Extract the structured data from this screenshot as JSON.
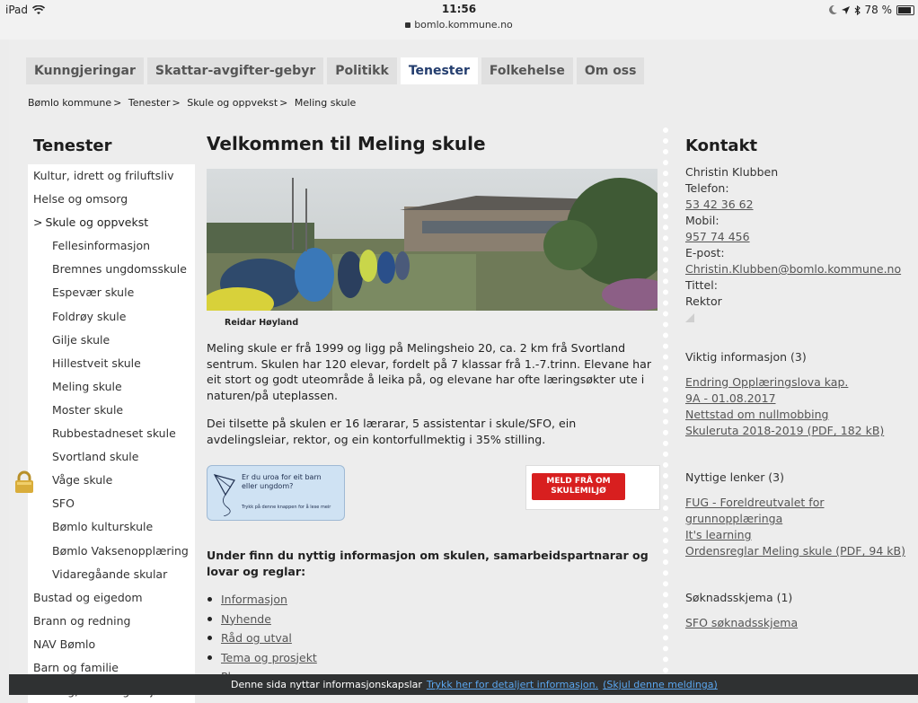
{
  "status_bar": {
    "device": "iPad",
    "time": "11:56",
    "url": "bomlo.kommune.no",
    "battery": "78 %",
    "battery_level": 0.78,
    "icons": [
      "wifi-icon",
      "moon-icon",
      "location-icon",
      "bluetooth-icon",
      "battery-icon"
    ]
  },
  "topnav": [
    {
      "label": "Kunngjeringar"
    },
    {
      "label": "Skattar-avgifter-gebyr"
    },
    {
      "label": "Politikk"
    },
    {
      "label": "Tenester",
      "active": true
    },
    {
      "label": "Folkehelse"
    },
    {
      "label": "Om oss"
    }
  ],
  "breadcrumb": [
    "Bømlo kommune",
    "Tenester",
    "Skule og oppvekst",
    "Meling skule"
  ],
  "breadcrumb_sep": ">",
  "sidebar": {
    "title": "Tenester",
    "items": [
      {
        "label": "Kultur, idrett og friluftsliv",
        "level": 0
      },
      {
        "label": "Helse og omsorg",
        "level": 0
      },
      {
        "label": "Skule og oppvekst",
        "level": 0,
        "selected": true,
        "prefix": ">"
      },
      {
        "label": "Fellesinformasjon",
        "level": 1
      },
      {
        "label": "Bremnes ungdomsskule",
        "level": 1
      },
      {
        "label": "Espevær skule",
        "level": 1
      },
      {
        "label": "Foldrøy skule",
        "level": 1
      },
      {
        "label": "Gilje skule",
        "level": 1
      },
      {
        "label": "Hillestveit skule",
        "level": 1
      },
      {
        "label": "Meling skule",
        "level": 1
      },
      {
        "label": "Moster skule",
        "level": 1
      },
      {
        "label": "Rubbestadneset skule",
        "level": 1
      },
      {
        "label": "Svortland skule",
        "level": 1
      },
      {
        "label": "Våge skule",
        "level": 1
      },
      {
        "label": "SFO",
        "level": 1
      },
      {
        "label": "Bømlo kulturskule",
        "level": 1
      },
      {
        "label": "Bømlo Vaksenopplæring",
        "level": 1
      },
      {
        "label": "Vidaregåande skular",
        "level": 1
      },
      {
        "label": "Bustad og eigedom",
        "level": 0
      },
      {
        "label": "Brann og redning",
        "level": 0
      },
      {
        "label": "NAV Bømlo",
        "level": 0
      },
      {
        "label": "Barn og familie",
        "level": 0
      },
      {
        "label": "Næring, natur og miljø",
        "level": 0
      }
    ]
  },
  "main": {
    "title": "Velkommen til Meling skule",
    "image_caption": "Reidar Høyland",
    "paragraph1": "Meling skule er frå 1999 og ligg på Melingsheio 20, ca. 2 km frå Svortland sentrum. Skulen har 120 elevar, fordelt på 7 klassar frå 1.-7.trinn. Elevane har eit stort og godt uteområde å leika på, og elevane har ofte læringsøkter ute i naturen/på uteplassen.",
    "paragraph2": "Dei tilsette på skulen er 16 lærarar, 5 assistentar i skule/SFO, ein avdelingsleiar, rektor, og ein kontorfullmektig i 35% stilling.",
    "banner_left_line1": "Er du uroa for eit barn",
    "banner_left_line2": "eller ungdom?",
    "banner_left_small": "Trykk på denne knappen for å lese meir",
    "banner_right_line1": "MELD FRÅ OM",
    "banner_right_line2": "SKULEMILJØ",
    "subheading": "Under finn du nyttig informasjon om skulen, samarbeidspartnarar og lovar og reglar:",
    "links": [
      "Informasjon",
      "Nyhende",
      "Råd og utval",
      "Tema og prosjekt",
      "Planar"
    ]
  },
  "contact": {
    "title": "Kontakt",
    "name": "Christin Klubben",
    "phone_label": "Telefon:",
    "phone": "53 42 36 62",
    "mobile_label": "Mobil:",
    "mobile": "957 74 456",
    "email_label": "E-post:",
    "email": "Christin.Klubben@bomlo.kommune.no",
    "title_label": "Tittel:",
    "role": "Rektor"
  },
  "important": {
    "heading": "Viktig informasjon (3)",
    "links": [
      "Endring Opplæringslova kap. 9A - 01.08.2017",
      "Nettstad om nullmobbing",
      "Skuleruta 2018-2019 (PDF, 182 kB)"
    ]
  },
  "useful": {
    "heading": "Nyttige lenker (3)",
    "links": [
      "FUG - Foreldreutvalet for grunnopplæringa",
      "It's learning",
      "Ordensreglar Meling skule (PDF, 94 kB)"
    ]
  },
  "forms": {
    "heading": "Søknadsskjema (1)",
    "links": [
      "SFO søknadsskjema"
    ]
  },
  "cookie_bar": {
    "text": "Denne sida nyttar informasjonskapslar",
    "link1": "Trykk her for detaljert informasjon.",
    "link2": "(Skjul denne meldinga)"
  }
}
